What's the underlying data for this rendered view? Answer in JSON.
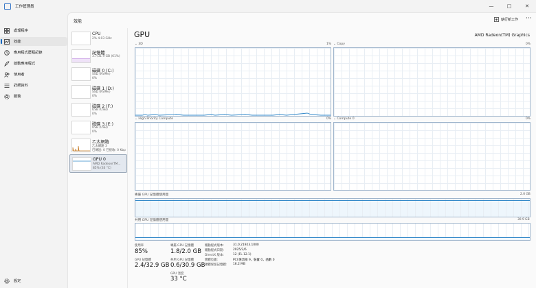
{
  "app": {
    "title": "工作管理員"
  },
  "sidebar": {
    "items": [
      {
        "label": "處理程序",
        "icon": "grid-icon"
      },
      {
        "label": "效能",
        "icon": "performance-icon"
      },
      {
        "label": "應用程式歷程記錄",
        "icon": "history-icon"
      },
      {
        "label": "啟動應用程式",
        "icon": "startup-icon"
      },
      {
        "label": "使用者",
        "icon": "users-icon"
      },
      {
        "label": "詳細資料",
        "icon": "details-icon"
      },
      {
        "label": "服務",
        "icon": "services-icon"
      }
    ],
    "settings": "設定"
  },
  "header": {
    "title": "效能",
    "run_task": "執行新工作",
    "more": "···"
  },
  "resources": [
    {
      "name": "CPU",
      "sub1": "2% 4.03 GHz",
      "sub2": ""
    },
    {
      "name": "記憶體",
      "sub1": "3.7/31.9 GB (61%)",
      "sub2": ""
    },
    {
      "name": "磁碟 0 (C:)",
      "sub1": "SSD (NVMe)",
      "sub2": "0%"
    },
    {
      "name": "磁碟 1 (D:)",
      "sub1": "SSD (NVMe)",
      "sub2": "0%"
    },
    {
      "name": "磁碟 2 (F:)",
      "sub1": "USB (USB)",
      "sub2": "0%"
    },
    {
      "name": "磁碟 3 (E:)",
      "sub1": "USB (USB)",
      "sub2": "0%"
    },
    {
      "name": "乙太網路",
      "sub1": "乙太網路 3",
      "sub2": "已傳送: 0 已接收: 0 Kbp"
    },
    {
      "name": "GPU 0",
      "sub1": "AMD Radeon(TM...",
      "sub2": "85% (33 °C)"
    }
  ],
  "gpu": {
    "title": "GPU",
    "model": "AMD Radeon(TM) Graphics",
    "engines": [
      {
        "label": "3D",
        "pct": "1%"
      },
      {
        "label": "Copy",
        "pct": "0%"
      },
      {
        "label": "High Priority Compute",
        "pct": "0%"
      },
      {
        "label": "Compute 0",
        "pct": "0%"
      }
    ],
    "dedicated_label": "專屬 GPU 記憶體使用量",
    "dedicated_max": "2.0 GB",
    "shared_label": "共用 GPU 記憶體使用量",
    "shared_max": "30.9 GB"
  },
  "stats": {
    "usage_label": "使用率",
    "usage": "85%",
    "dedicated_label": "專屬 GPU 記憶體",
    "dedicated": "1.8/2.0 GB",
    "gpu_mem_label": "GPU 記憶體",
    "gpu_mem": "2.4/32.9 GB",
    "shared_label": "共用 GPU 記憶體",
    "shared": "0.6/30.9 GB",
    "temp_label": "GPU 溫度",
    "temp": "33 °C"
  },
  "details": [
    {
      "k": "驅動程式版本:",
      "v": "31.0.21923.1000"
    },
    {
      "k": "驅動程式日期:",
      "v": "2025/3/6"
    },
    {
      "k": "DirectX 版本:",
      "v": "12 (FL 12.1)"
    },
    {
      "k": "實體位置:",
      "v": "PCI 匯流排 9，裝置 0，函數 0"
    },
    {
      "k": "硬體保留記憶體:",
      "v": "16.2 MB"
    }
  ],
  "colors": {
    "accent": "#0067c0",
    "memory": "#8b2fc9",
    "network": "#c77c26",
    "gpu": "#2e86c8"
  }
}
